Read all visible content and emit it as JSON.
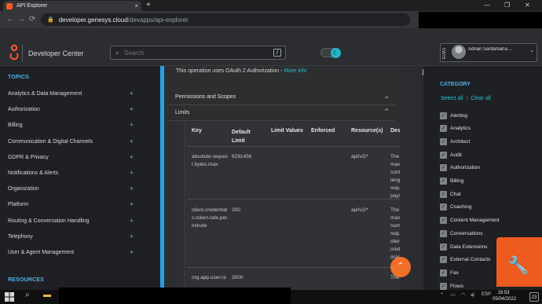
{
  "browser": {
    "tab_title": "API Explorer",
    "new_tab": "+",
    "close_tab": "×",
    "url_host": "developer.genesys.cloud",
    "url_path": "/devapps/api-explorer",
    "back": "←",
    "forward": "→",
    "reload": "⟳"
  },
  "header": {
    "title": "Developer Center",
    "search_placeholder": "Search",
    "search_shortcut": "/",
    "region": "EUW1",
    "user_name": "Adrián Santamaría ..."
  },
  "sidebar": {
    "topics_heading": "TOPICS",
    "items": [
      {
        "label": "Analytics & Data Management"
      },
      {
        "label": "Authorization"
      },
      {
        "label": "Billing"
      },
      {
        "label": "Communication & Digital Channels"
      },
      {
        "label": "GDPR & Privacy"
      },
      {
        "label": "Notifications & Alerts"
      },
      {
        "label": "Organization"
      },
      {
        "label": "Platform"
      },
      {
        "label": "Routing & Conversation Handling"
      },
      {
        "label": "Telephony"
      },
      {
        "label": "User & Agent Management"
      }
    ],
    "resources_heading": "RESOURCES"
  },
  "main": {
    "oauth_text": "This operation uses OAuth 2 Authorization - ",
    "more_info": "More info",
    "permissions_label": "Permissions and Scopes",
    "limits_label": "Limits",
    "columns": [
      "Key",
      "Default Limit",
      "Limit Values",
      "Enforced",
      "Resource(s)",
      "Description"
    ],
    "rows": [
      {
        "key": "absolute.request.bytes.max",
        "default_limit": "6291456",
        "resource": "api/v2/*",
        "description": "The absolute maximum content length of a request payload"
      },
      {
        "key": "client.credentials.token.rate.per.minute",
        "default_limit": "300",
        "resource": "api/v2/*",
        "description": "The maximum number of requests per client credentials grant token per minute"
      },
      {
        "key": "org.app.user.ra",
        "default_limit": "3000",
        "resource": "",
        "description": "The maximum"
      }
    ]
  },
  "categories": {
    "heading": "CATEGORY",
    "select_all": "Select all",
    "clear_all": "Clear all",
    "items": [
      "Alerting",
      "Analytics",
      "Architect",
      "Audit",
      "Authorization",
      "Billing",
      "Chat",
      "Coaching",
      "Content Management",
      "Conversations",
      "Data Extensions",
      "External Contacts",
      "Fax",
      "Flows"
    ]
  },
  "taskbar": {
    "lang": "ESP",
    "time": "16:53",
    "date": "05/04/2022",
    "notifications": "23"
  },
  "colors": {
    "accent": "#2aa0e6",
    "link": "#22c4d0",
    "brand_orange": "#ee5a1f"
  }
}
